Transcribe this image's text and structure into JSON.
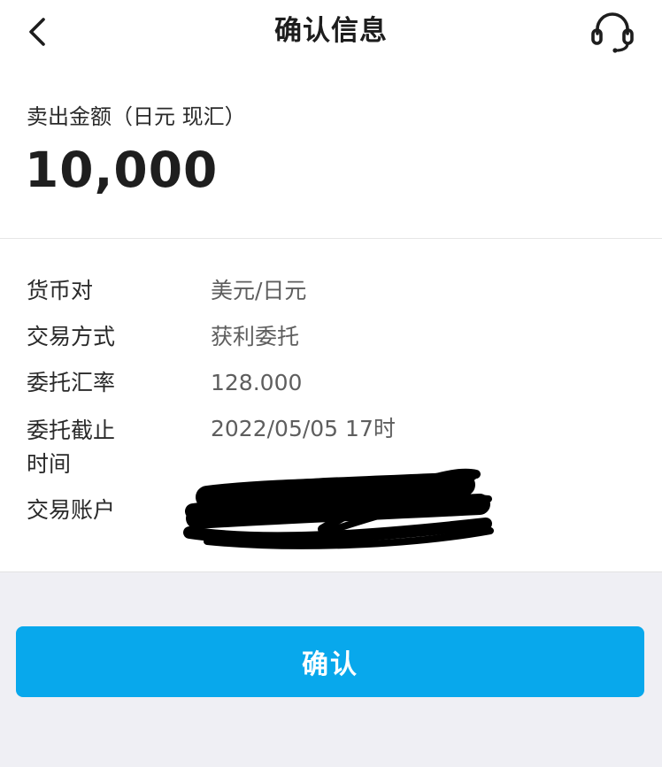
{
  "header": {
    "title": "确认信息",
    "back_icon": "chevron-left-icon",
    "support_icon": "headset-icon"
  },
  "amount": {
    "label": "卖出金额（日元 现汇）",
    "value": "10,000"
  },
  "details": [
    {
      "label": "货币对",
      "value": "美元/日元"
    },
    {
      "label": "交易方式",
      "value": "获利委托"
    },
    {
      "label": "委托汇率",
      "value": "128.000"
    },
    {
      "label": "委托截止时间",
      "value": "2022/05/05 17时"
    },
    {
      "label": "交易账户",
      "value": ""
    }
  ],
  "confirm_button": {
    "label": "确认"
  },
  "colors": {
    "accent": "#08a8ec",
    "page_background": "#efeff4",
    "value_text": "#5e5e5e"
  }
}
